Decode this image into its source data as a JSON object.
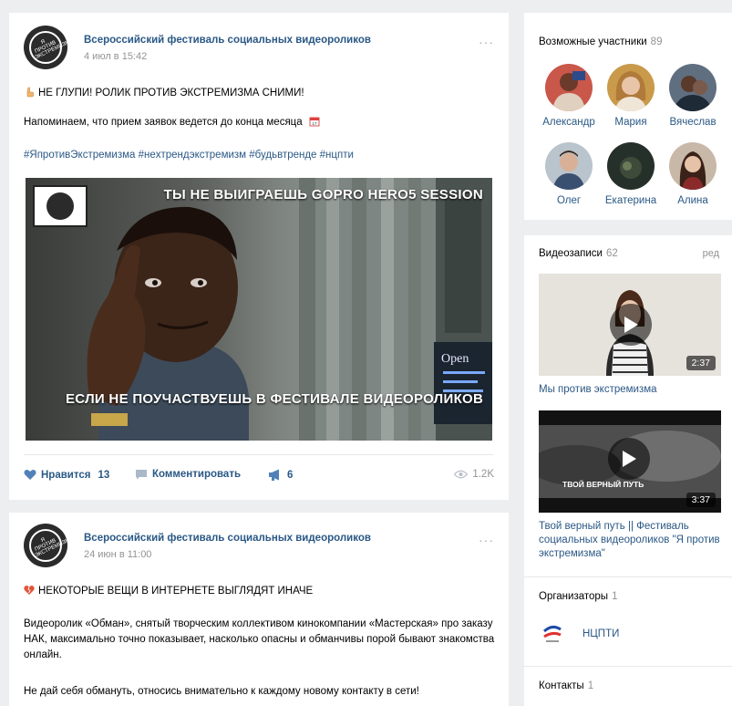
{
  "posts": [
    {
      "author": "Всероссийский фестиваль социальных видеороликов",
      "date": "4 июл в 15:42",
      "avatar_text": "Я ПРОТИВ ЭКСТРЕМИЗМА",
      "line1": "НЕ ГЛУПИ! РОЛИК ПРОТИВ ЭКСТРЕМИЗМА СНИМИ!",
      "line2": "Напоминаем, что прием заявок ведется до конца месяца",
      "hashtags": "#ЯпротивЭкстремизма #неxтрендэкстремизм #будьвтренде #нцпти",
      "image": {
        "caption_top": "ТЫ НЕ ВЫИГРАЕШЬ GOPRO HERO5 SESSION",
        "caption_bottom": "ЕСЛИ НЕ ПОУЧАСТВУЕШЬ В ФЕСТИВАЛЕ ВИДЕОРОЛИКОВ",
        "sign_text": "Open"
      },
      "actions": {
        "like_label": "Нравится",
        "like_count": "13",
        "comment_label": "Комментировать",
        "share_count": "6",
        "views": "1.2K"
      }
    },
    {
      "author": "Всероссийский фестиваль социальных видеороликов",
      "date": "24 июн в 11:00",
      "avatar_text": "Я ПРОТИВ ЭКСТРЕМИЗМА",
      "line1": "НЕКОТОРЫЕ ВЕЩИ В ИНТЕРНЕТЕ ВЫГЛЯДЯТ ИНАЧЕ",
      "para": "Видеоролик «Обман», снятый творческим коллективом кинокомпании «Мастерская» про заказу НАК, максимально точно показывает, насколько опасны и обманчивы порой бывают знакомства онлайн.",
      "line3": "Не дай себя обмануть, относись внимательно к каждому новому контакту в сети!"
    }
  ],
  "members_widget": {
    "title": "Возможные участники",
    "count": "89",
    "members": [
      {
        "name": "Александр",
        "bg": "#c9574a"
      },
      {
        "name": "Мария",
        "bg": "#c99a4a"
      },
      {
        "name": "Вячеслав",
        "bg": "#5f6f80"
      },
      {
        "name": "Олег",
        "bg": "#b9c4cc"
      },
      {
        "name": "Екатерина",
        "bg": "#26302a"
      },
      {
        "name": "Алина",
        "bg": "#c8b8a8"
      }
    ]
  },
  "videos_widget": {
    "title": "Видеозаписи",
    "count": "62",
    "edit": "ред",
    "videos": [
      {
        "title": "Мы против экстремизма",
        "duration": "2:37",
        "thumb_text": ""
      },
      {
        "title": "Твой верный путь || Фестиваль социальных видеороликов \"Я против экстремизма\"",
        "duration": "3:37",
        "thumb_text": "ТВОЙ ВЕРНЫЙ ПУТЬ"
      }
    ],
    "organizers_title": "Организаторы",
    "organizers_count": "1",
    "organizer_name": "НЦПТИ",
    "contacts_title": "Контакты",
    "contacts_count": "1"
  },
  "colors": {
    "link": "#2a5885",
    "muted": "#939393",
    "bg": "#edeef0"
  }
}
